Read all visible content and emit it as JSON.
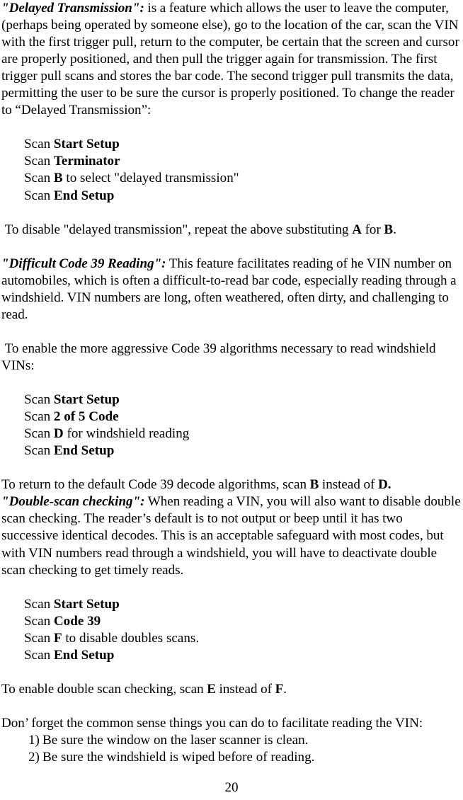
{
  "page": {
    "number": "20"
  },
  "sections": [
    {
      "id": "delayed-transmission",
      "heading": "\"Delayed Transmission\":",
      "paragraph": " is a feature which allows the user to leave the computer, (perhaps being operated by someone else), go to the location of the car, scan the VIN with the first trigger pull, return to the computer, be certain that the screen and cursor are properly positioned, and then pull the trigger again for transmission. The first trigger pull scans and stores the bar code. The second trigger pull transmits the data, permitting the user to be sure the cursor is properly positioned. To change the reader to “Delayed Transmission”:",
      "scan_steps": [
        {
          "prefix": "Scan ",
          "bold": "Start Setup",
          "suffix": ""
        },
        {
          "prefix": "Scan ",
          "bold": "Terminator",
          "suffix": ""
        },
        {
          "prefix": "Scan ",
          "bold": "B",
          "suffix": " to select \"delayed transmission\""
        },
        {
          "prefix": "Scan ",
          "bold": "End Setup",
          "suffix": ""
        }
      ],
      "closing": {
        "before": " To disable \"delayed transmission\", repeat the above substituting ",
        "bold1": "A",
        "middle": " for ",
        "bold2": "B",
        "after": "."
      }
    },
    {
      "id": "difficult-code-39-reading",
      "heading": "\"Difficult Code 39 Reading\":",
      "paragraph": " This feature facilitates reading of he VIN number on automobiles, which is often a difficult-to-read bar code, especially reading through a windshield.  VIN numbers are long, often weathered, often dirty, and challenging to read.",
      "intro": " To enable the more aggressive Code 39 algorithms necessary to read windshield VINs:",
      "scan_steps": [
        {
          "prefix": "Scan ",
          "bold": "Start Setup",
          "suffix": ""
        },
        {
          "prefix": "Scan ",
          "bold": "2 of 5 Code",
          "suffix": ""
        },
        {
          "prefix": "Scan ",
          "bold": "D",
          "suffix": " for windshield reading"
        },
        {
          "prefix": "Scan ",
          "bold": "End Setup",
          "suffix": ""
        }
      ],
      "closing": {
        "before": "To return to the default Code 39 decode algorithms, scan ",
        "bold1": "B",
        "middle": " instead of ",
        "bold2": "D.",
        "after": ""
      }
    },
    {
      "id": "double-scan-checking",
      "heading": "\"Double-scan checking\":",
      "paragraph": " When reading a VIN, you will also want to disable double scan checking. The reader’s default is to not output or beep until it has two successive identical decodes. This is an acceptable safeguard with most codes, but with VIN numbers read through a windshield, you will have to deactivate double scan checking to get timely reads.",
      "scan_steps": [
        {
          "prefix": "Scan ",
          "bold": "Start Setup",
          "suffix": ""
        },
        {
          "prefix": "Scan ",
          "bold": "Code 39",
          "suffix": ""
        },
        {
          "prefix": "Scan ",
          "bold": "F",
          "suffix": " to disable doubles scans."
        },
        {
          "prefix": "Scan ",
          "bold": "End Setup",
          "suffix": ""
        }
      ],
      "closing": {
        "before": "To enable double scan checking, scan ",
        "bold1": "E",
        "middle": " instead of ",
        "bold2": "F",
        "after": "."
      }
    }
  ],
  "tips": {
    "intro": "Don’ forget the common sense things you can do to facilitate reading the VIN:",
    "items": [
      {
        "marker": "1)",
        "text": "Be sure the window on the laser scanner is clean."
      },
      {
        "marker": "2)",
        "text": "Be sure the windshield is wiped before of reading."
      }
    ]
  }
}
